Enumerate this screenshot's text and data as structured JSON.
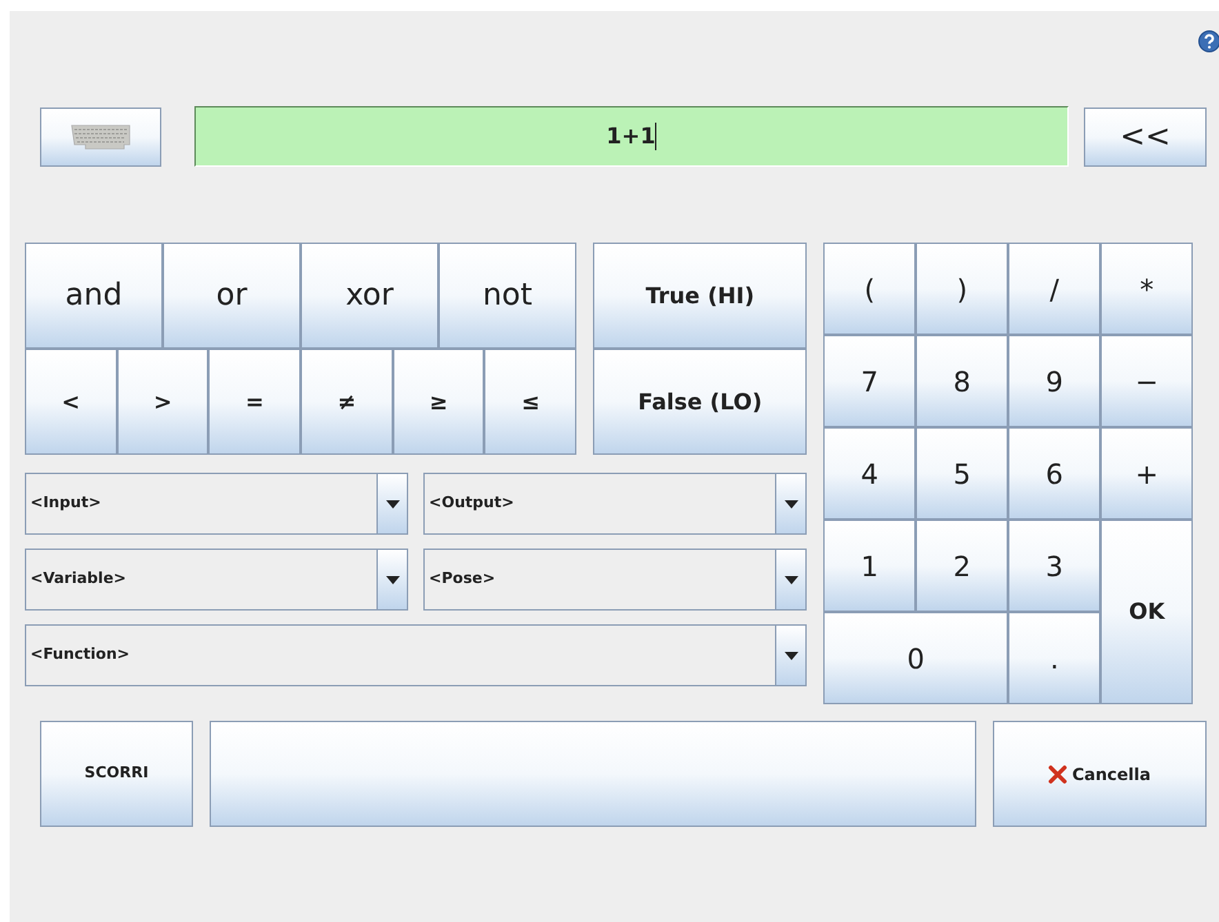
{
  "expression": {
    "value": "1+1"
  },
  "back_button": {
    "label": "<<"
  },
  "logic_ops": [
    "and",
    "or",
    "xor",
    "not"
  ],
  "comparison_ops": [
    "<",
    ">",
    "=",
    "≠",
    "≥",
    "≤"
  ],
  "bool_buttons": [
    "True (HI)",
    "False (LO)"
  ],
  "dropdowns": [
    {
      "value": "<Input>",
      "kind": "half"
    },
    {
      "value": "<Output>",
      "kind": "half"
    },
    {
      "value": "<Variable>",
      "kind": "half"
    },
    {
      "value": "<Pose>",
      "kind": "half"
    },
    {
      "value": "<Function>",
      "kind": "full"
    }
  ],
  "numpad": [
    {
      "label": "(",
      "kind": "key"
    },
    {
      "label": ")",
      "kind": "key"
    },
    {
      "label": "/",
      "kind": "key"
    },
    {
      "label": "*",
      "kind": "key"
    },
    {
      "label": "7",
      "kind": "key"
    },
    {
      "label": "8",
      "kind": "key"
    },
    {
      "label": "9",
      "kind": "key"
    },
    {
      "label": "−",
      "kind": "key"
    },
    {
      "label": "4",
      "kind": "key"
    },
    {
      "label": "5",
      "kind": "key"
    },
    {
      "label": "6",
      "kind": "key"
    },
    {
      "label": "+",
      "kind": "key"
    },
    {
      "label": "1",
      "kind": "key"
    },
    {
      "label": "2",
      "kind": "key"
    },
    {
      "label": "3",
      "kind": "key"
    },
    {
      "label": "OK",
      "kind": "tall"
    },
    {
      "label": "0",
      "kind": "wide"
    },
    {
      "label": ".",
      "kind": "key"
    }
  ],
  "scroll_button": {
    "label": "SCORRI"
  },
  "cancel_button": {
    "label": "Cancella"
  }
}
